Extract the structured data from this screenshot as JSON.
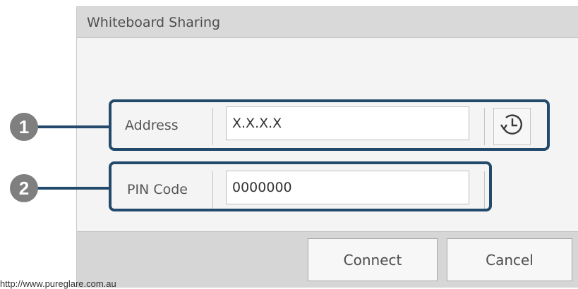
{
  "dialog": {
    "title": "Whiteboard Sharing",
    "address_label": "Address",
    "address_value": "X.X.X.X",
    "pin_label": "PIN Code",
    "pin_value": "0000000",
    "history_icon": "history-clock-icon",
    "connect_label": "Connect",
    "cancel_label": "Cancel"
  },
  "callouts": {
    "one": "1",
    "two": "2",
    "color": "#234a6c",
    "dot_color": "#7f7f7f"
  },
  "footer_url": "http://www.pureglare.com.au"
}
